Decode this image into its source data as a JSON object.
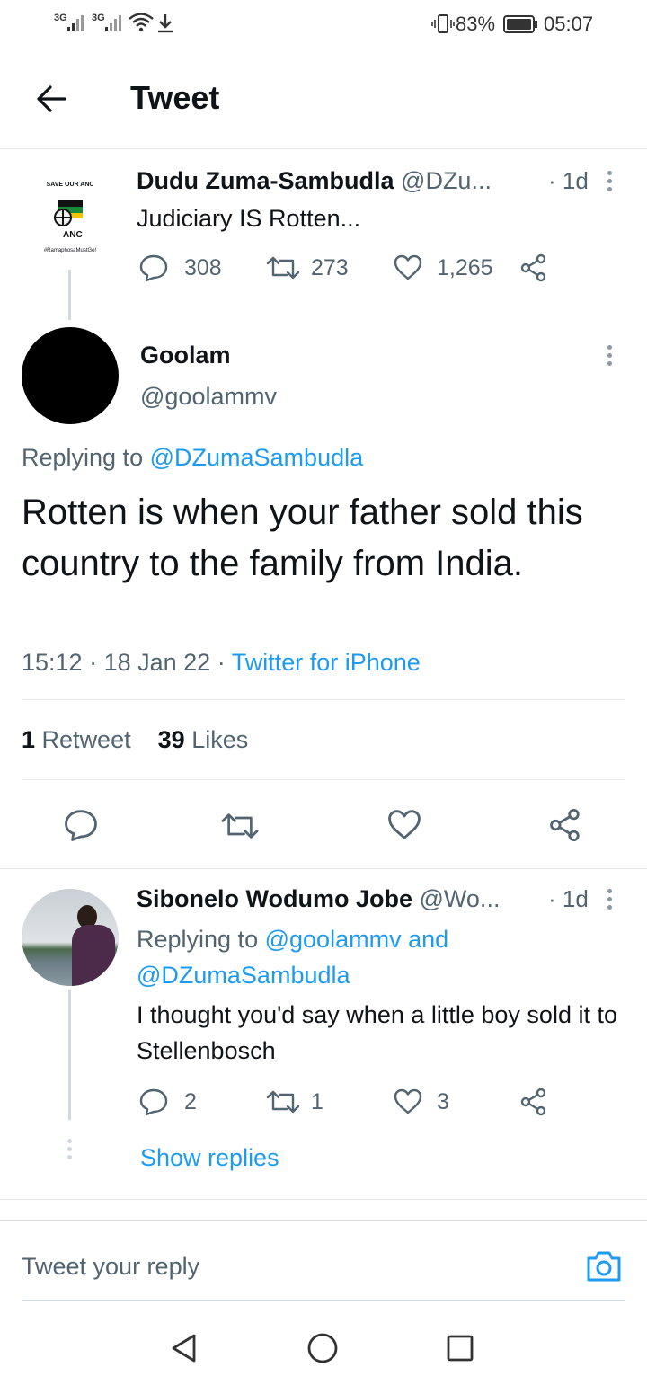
{
  "status_bar": {
    "signal1": "3G",
    "signal2": "3G",
    "battery_pct": "83%",
    "time": "05:07"
  },
  "header": {
    "title": "Tweet"
  },
  "parent_tweet": {
    "avatar_text_top": "SAVE OUR ANC",
    "avatar_text_mid": "ANC",
    "avatar_text_bottom": "#RamaphosaMustGo!",
    "display_name": "Dudu Zuma-Sambudla",
    "handle": "@DZu...",
    "time": "· 1d",
    "text": "Judiciary IS Rotten...",
    "replies": "308",
    "retweets": "273",
    "likes": "1,265"
  },
  "main_tweet": {
    "display_name": "Goolam",
    "handle": "@goolammv",
    "replying_label": "Replying to",
    "replying_to": "@DZumaSambudla",
    "text": "Rotten is when your father sold this country to the family from India.",
    "time": "15:12",
    "date": "18 Jan 22",
    "source": "Twitter for iPhone",
    "retweet_count": "1",
    "retweet_label": "Retweet",
    "like_count": "39",
    "like_label": "Likes"
  },
  "reply_tweet": {
    "display_name": "Sibonelo Wodumo Jobe",
    "handle": "@Wo...",
    "time": "· 1d",
    "replying_label": "Replying to",
    "replying_to_1": "@goolammv",
    "and_label": "and",
    "replying_to_2": "@DZumaSambudla",
    "text": "I thought you'd say when a little boy sold it to Stellenbosch",
    "replies": "2",
    "retweets": "1",
    "likes": "3",
    "show_replies": "Show replies"
  },
  "reply_bar": {
    "placeholder": "Tweet your reply"
  },
  "colors": {
    "accent": "#1d9bf0",
    "text": "#0f1419",
    "secondary": "#536471"
  }
}
